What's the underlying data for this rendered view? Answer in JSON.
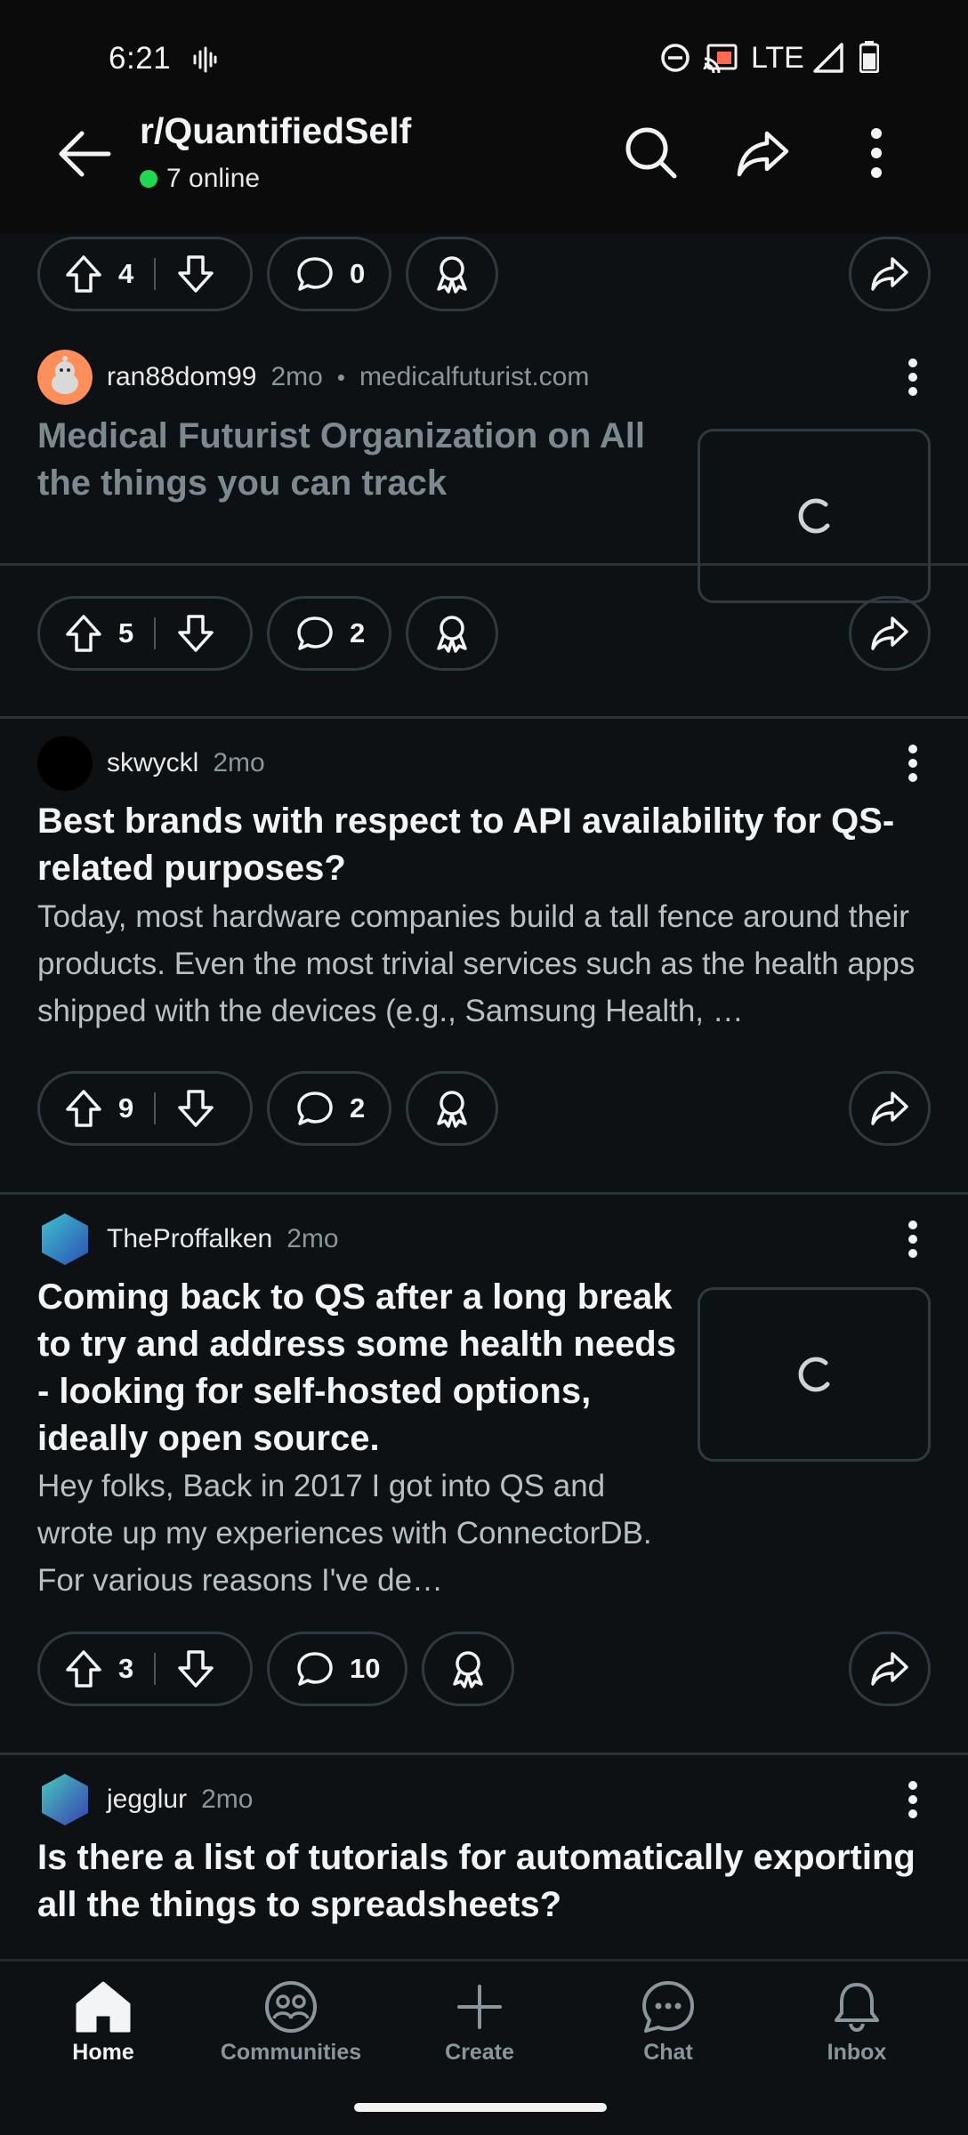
{
  "status_bar": {
    "time": "6:21",
    "network": "LTE"
  },
  "header": {
    "subreddit": "r/QuantifiedSelf",
    "online_count": "7 online"
  },
  "posts": [
    {
      "partial": true,
      "upvotes": "4",
      "comments": "0"
    },
    {
      "author": "ran88dom99",
      "age": "2mo",
      "domain": "medicalfuturist.com",
      "title": "Medical Futurist Organization on All the things you can track",
      "upvotes": "5",
      "comments": "2",
      "has_thumbnail": true
    },
    {
      "author": "skwyckl",
      "age": "2mo",
      "title": "Best brands with respect to API availability for QS-related purposes?",
      "body": "Today, most hardware companies build a tall fence around their products. Even the most trivial services such as the health apps shipped with the devices (e.g., Samsung Health, …",
      "upvotes": "9",
      "comments": "2"
    },
    {
      "author": "TheProffalken",
      "age": "2mo",
      "title": "Coming back to QS after a long break to try and address some health needs - looking for self-hosted options, ideally open source.",
      "body": "Hey folks, Back in 2017 I got into QS and wrote up my experiences with ConnectorDB. For various reasons I've de…",
      "upvotes": "3",
      "comments": "10",
      "has_thumbnail": true
    },
    {
      "author": "jegglur",
      "age": "2mo",
      "title": "Is there a list of tutorials for automatically exporting all the things to spreadsheets?"
    }
  ],
  "bottom_nav": [
    {
      "label": "Home",
      "icon": "home-icon",
      "active": true
    },
    {
      "label": "Communities",
      "icon": "communities-icon",
      "active": false
    },
    {
      "label": "Create",
      "icon": "plus-icon",
      "active": false
    },
    {
      "label": "Chat",
      "icon": "chat-icon",
      "active": false
    },
    {
      "label": "Inbox",
      "icon": "bell-icon",
      "active": false
    }
  ],
  "colors": {
    "background": "#0e1113",
    "online_dot": "#1ed84f",
    "text_primary": "#f2f4f5",
    "text_muted": "#8a969c"
  }
}
